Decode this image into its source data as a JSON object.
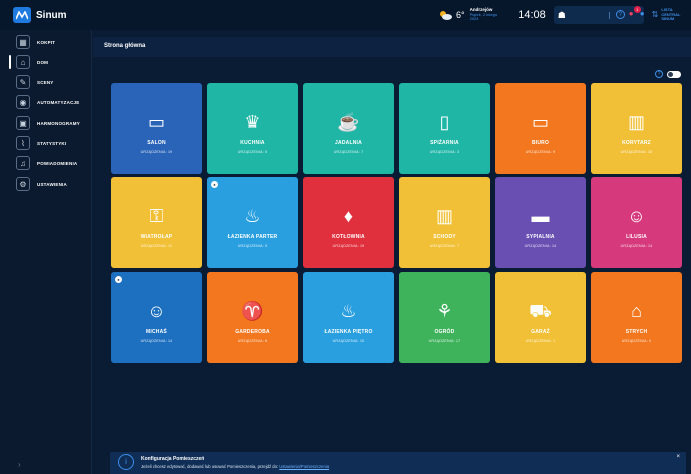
{
  "app": {
    "name": "Sinum"
  },
  "topbar": {
    "temperature": "6°",
    "day_name": "Andrzejów",
    "date": "Piątek, 2 lutego 2024",
    "time": "14:08",
    "notifications_count": "1",
    "central_line1": "LISTA",
    "central_line2": "CENTRAL SINUM"
  },
  "sidebar": {
    "items": [
      {
        "label": "KOKPIT",
        "icon": "dashboard-icon",
        "glyph": "▦"
      },
      {
        "label": "DOM",
        "icon": "home-icon",
        "glyph": "⌂"
      },
      {
        "label": "SCENY",
        "icon": "wand-icon",
        "glyph": "✎"
      },
      {
        "label": "AUTOMATYZACJE",
        "icon": "automation-icon",
        "glyph": "◉"
      },
      {
        "label": "HARMONOGRAMY",
        "icon": "calendar-icon",
        "glyph": "▣"
      },
      {
        "label": "STATYSTYKI",
        "icon": "chart-icon",
        "glyph": "⌇"
      },
      {
        "label": "POWIADOMIENIA",
        "icon": "bell-icon",
        "glyph": "♫"
      },
      {
        "label": "USTAWIENIA",
        "icon": "gear-icon",
        "glyph": "⚙"
      }
    ]
  },
  "page": {
    "title": "Strona główna"
  },
  "rooms": [
    {
      "name": "SALON",
      "count": "URZĄDZENIA: 19",
      "color": "#2a64b8",
      "glyph": "▭",
      "icon": "tv-icon",
      "badge": false
    },
    {
      "name": "KUCHNIA",
      "count": "URZĄDZENIA: 5",
      "color": "#1fb6a6",
      "glyph": "♛",
      "icon": "chef-hat-icon",
      "badge": false
    },
    {
      "name": "JADALNIA",
      "count": "URZĄDZENIA: 7",
      "color": "#1fb6a6",
      "glyph": "☕",
      "icon": "coffee-icon",
      "badge": false
    },
    {
      "name": "SPIŻARNIA",
      "count": "URZĄDZENIA: 3",
      "color": "#1fb6a6",
      "glyph": "▯",
      "icon": "fridge-icon",
      "badge": false
    },
    {
      "name": "BIURO",
      "count": "URZĄDZENIA: 9",
      "color": "#f2771e",
      "glyph": "▭",
      "icon": "laptop-icon",
      "badge": false
    },
    {
      "name": "KORYTARZ",
      "count": "URZĄDZENIA: 15",
      "color": "#f2c037",
      "glyph": "▥",
      "icon": "door-icon",
      "badge": false
    },
    {
      "name": "WIATROŁAP",
      "count": "URZĄDZENIA: 11",
      "color": "#f2c037",
      "glyph": "⚿",
      "icon": "door-handle-icon",
      "badge": false
    },
    {
      "name": "ŁAZIENKA PARTER",
      "count": "URZĄDZENIA: 5",
      "color": "#2a9fe0",
      "glyph": "♨",
      "icon": "bathtub-icon",
      "badge": true
    },
    {
      "name": "KOTŁOWNIA",
      "count": "URZĄDZENIA: 19",
      "color": "#e0303e",
      "glyph": "♦",
      "icon": "flame-icon",
      "badge": false
    },
    {
      "name": "SCHODY",
      "count": "URZĄDZENIA: 7",
      "color": "#f2c037",
      "glyph": "▥",
      "icon": "door-icon",
      "badge": false
    },
    {
      "name": "SYPIALNIA",
      "count": "URZĄDZENIA: 14",
      "color": "#6a4fb3",
      "glyph": "▬",
      "icon": "bed-icon",
      "badge": false
    },
    {
      "name": "LILUSIA",
      "count": "URZĄDZENIA: 14",
      "color": "#d63a7c",
      "glyph": "☺",
      "icon": "girl-face-icon",
      "badge": false
    },
    {
      "name": "MICHAŚ",
      "count": "URZĄDZENIA: 14",
      "color": "#1d6fc0",
      "glyph": "☺",
      "icon": "boy-face-icon",
      "badge": true
    },
    {
      "name": "GARDEROBA",
      "count": "URZĄDZENIA: 8",
      "color": "#f2771e",
      "glyph": "♈",
      "icon": "tshirt-icon",
      "badge": false
    },
    {
      "name": "ŁAZIENKA PIĘTRO",
      "count": "URZĄDZENIA: 10",
      "color": "#2a9fe0",
      "glyph": "♨",
      "icon": "bathtub-icon",
      "badge": false
    },
    {
      "name": "OGRÓD",
      "count": "URZĄDZENIA: 17",
      "color": "#3fb35c",
      "glyph": "⚘",
      "icon": "plant-icon",
      "badge": false
    },
    {
      "name": "GARAŻ",
      "count": "URZĄDZENIA: 1",
      "color": "#f2c037",
      "glyph": "⛟",
      "icon": "car-icon",
      "badge": false
    },
    {
      "name": "STRYCH",
      "count": "URZĄDZENIA: 0",
      "color": "#f2771e",
      "glyph": "⌂",
      "icon": "roof-icon",
      "badge": false
    }
  ],
  "banner": {
    "title": "Konfiguracja Pomieszczeń",
    "text": "Jeżeli chcesz edytować, dodawać lub usuwać Pomieszczenia, przejdź do: ",
    "link": "Ustawienia/Pomieszczenia"
  },
  "colors": {
    "background": "#0b1a2e",
    "accent": "#3d8ee8"
  }
}
